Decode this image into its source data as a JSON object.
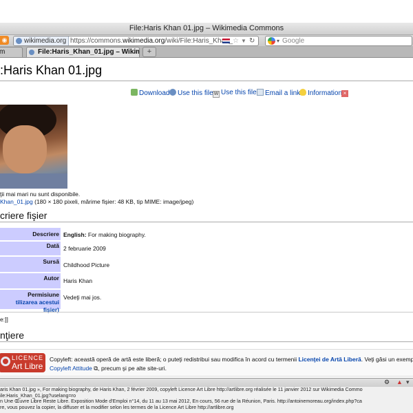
{
  "window": {
    "title": "File:Haris Khan 01.jpg – Wikimedia Commons"
  },
  "navbar": {
    "site_identity": "wikimedia.org",
    "url_prefix": "https://commons.",
    "url_domain": "wikimedia.org",
    "url_path": "/wiki/File:Haris_Khan_",
    "search_placeholder": "Google",
    "rss_icon": "rss-icon"
  },
  "tabs": [
    {
      "label": "m"
    },
    {
      "label": "File:Haris_Khan_01.jpg – Wikime...",
      "close": "×"
    }
  ],
  "new_tab_label": "+",
  "page": {
    "title": ":Haris Khan 01.jpg",
    "toolbar": {
      "download": "Download",
      "use_file_1": "Use this file",
      "use_file_2": "Use this file",
      "email": "Email a link",
      "information": "Information"
    },
    "no_larger": "ţii mai mari nu sunt disponibile.",
    "file_link": "Khan_01.jpg",
    "file_meta": " (180 × 180 pixeli, mărime fişier: 48 KB, tip MIME: image/jpeg)",
    "section_description": "criere fişier",
    "rows": [
      {
        "label": "Descriere",
        "value_bold": "English:",
        "value": " For making biography."
      },
      {
        "label": "Dată",
        "value": "2 februarie 2009"
      },
      {
        "label": "Sursă",
        "value": "Childhood Picture"
      },
      {
        "label": "Autor",
        "value": "Haris Khan"
      },
      {
        "label": "Permisiune",
        "sublabel": "tilizarea acestui fişier)",
        "value": "Vedeţi mai jos."
      }
    ],
    "snippet": "e:]]",
    "section_license": "nţiere",
    "license": {
      "logo_line1": "LICENCE",
      "logo_line2": "Art Libre",
      "text_a": "Copyleft: această operă de artă este liberă; o puteţi redistribui sau modifica în acord cu termenii ",
      "text_link": "Licenţei de Artă Liberă",
      "text_b": ". Veţi găsi un exemplar al",
      "text2_link": "Copyleft Attitude",
      "text2_b": " ⧉, precum şi pe alte site-uri."
    }
  },
  "status": {
    "line1": "aris Khan 01.jpg », For making biography, de Haris Khan, 2 février 2009, copyleft Licence Art Libre http://artlibre.org réalisée le 11 janvier 2012 sur Wikimedia Commo",
    "line2": "ile:Haris_Khan_01.jpg?uselang=ro",
    "line3": "n Une Œuvre Libre Reste Libre. Exposition Mode d'Emploi n°14, du 11 au 13 mai 2012, En cours, 56 rue de la Réunion, Paris. http://antoinemoreau.org/index.php?ca",
    "line4": "re, vous pouvez la copier, la diffuser et la modifier selon les termes de la Licence Art Libre http://artlibre.org"
  }
}
